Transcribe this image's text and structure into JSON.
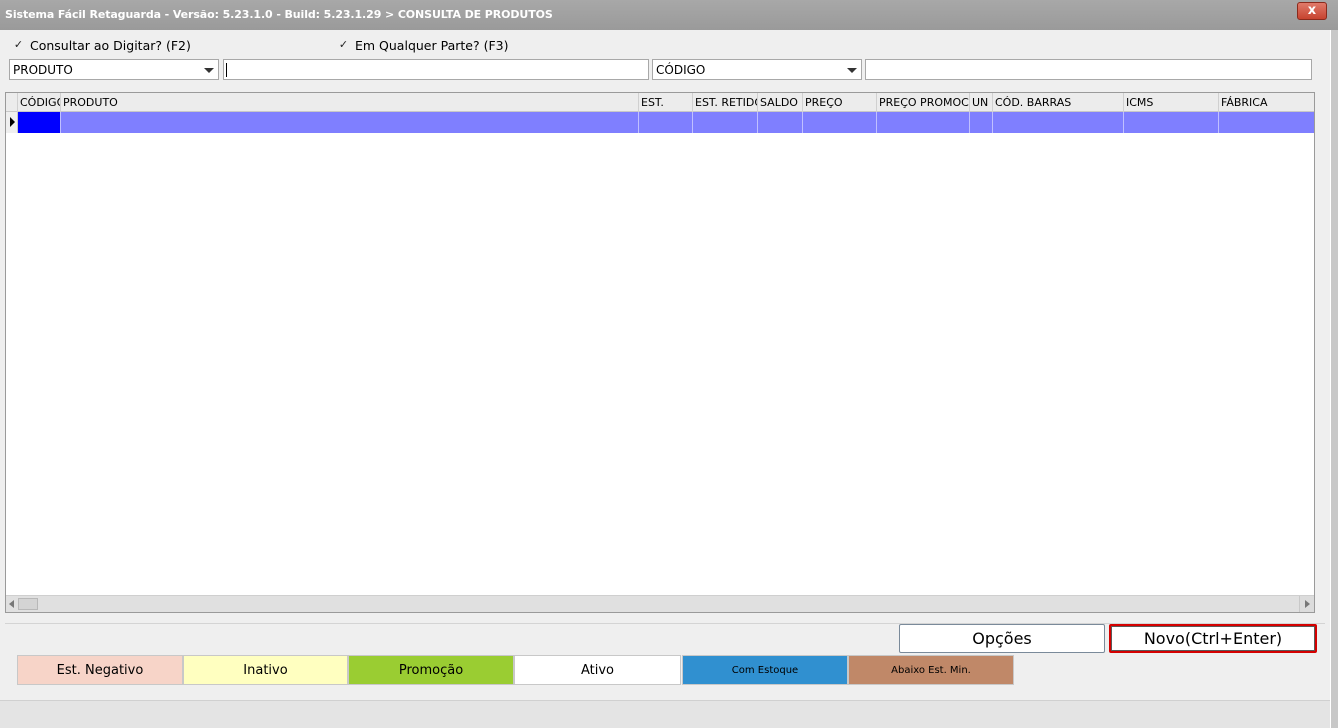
{
  "window": {
    "title": "Sistema Fácil Retaguarda - Versão: 5.23.1.0  - Build: 5.23.1.29 > CONSULTA DE PRODUTOS",
    "close_label": "x"
  },
  "filters": {
    "consultar_label": "Consultar ao Digitar? (F2)",
    "consultar_checked": true,
    "qualquer_label": "Em Qualquer Parte? (F3)",
    "qualquer_checked": true,
    "field1_value": "PRODUTO",
    "search1_value": "",
    "field2_value": "CÓDIGO",
    "search2_value": ""
  },
  "grid": {
    "columns": [
      "CÓDIGO",
      "PRODUTO",
      "EST.",
      "EST. RETIDO",
      "SALDO",
      "PREÇO",
      "PREÇO PROMOCIONAL",
      "UN",
      "CÓD. BARRAS",
      "ICMS",
      "FÁBRICA"
    ],
    "rows": [
      [
        "",
        "",
        "",
        "",
        "",
        "",
        "",
        "",
        "",
        "",
        ""
      ]
    ]
  },
  "buttons": {
    "opcoes_label": "Opções",
    "novo_label": "Novo(Ctrl+Enter)"
  },
  "legend": [
    {
      "label": "Est. Negativo",
      "color": "#f7d4c8"
    },
    {
      "label": "Inativo",
      "color": "#ffffc0"
    },
    {
      "label": "Promoção",
      "color": "#9acd32"
    },
    {
      "label": "Ativo",
      "color": "#ffffff"
    },
    {
      "label": "Com Estoque",
      "color": "#3090d0"
    },
    {
      "label": "Abaixo Est. Min.",
      "color": "#c08868"
    }
  ],
  "colors": {
    "selected_row": "#7f7fff",
    "selected_cell": "#0000ff",
    "primary_button_border": "#d40000"
  }
}
